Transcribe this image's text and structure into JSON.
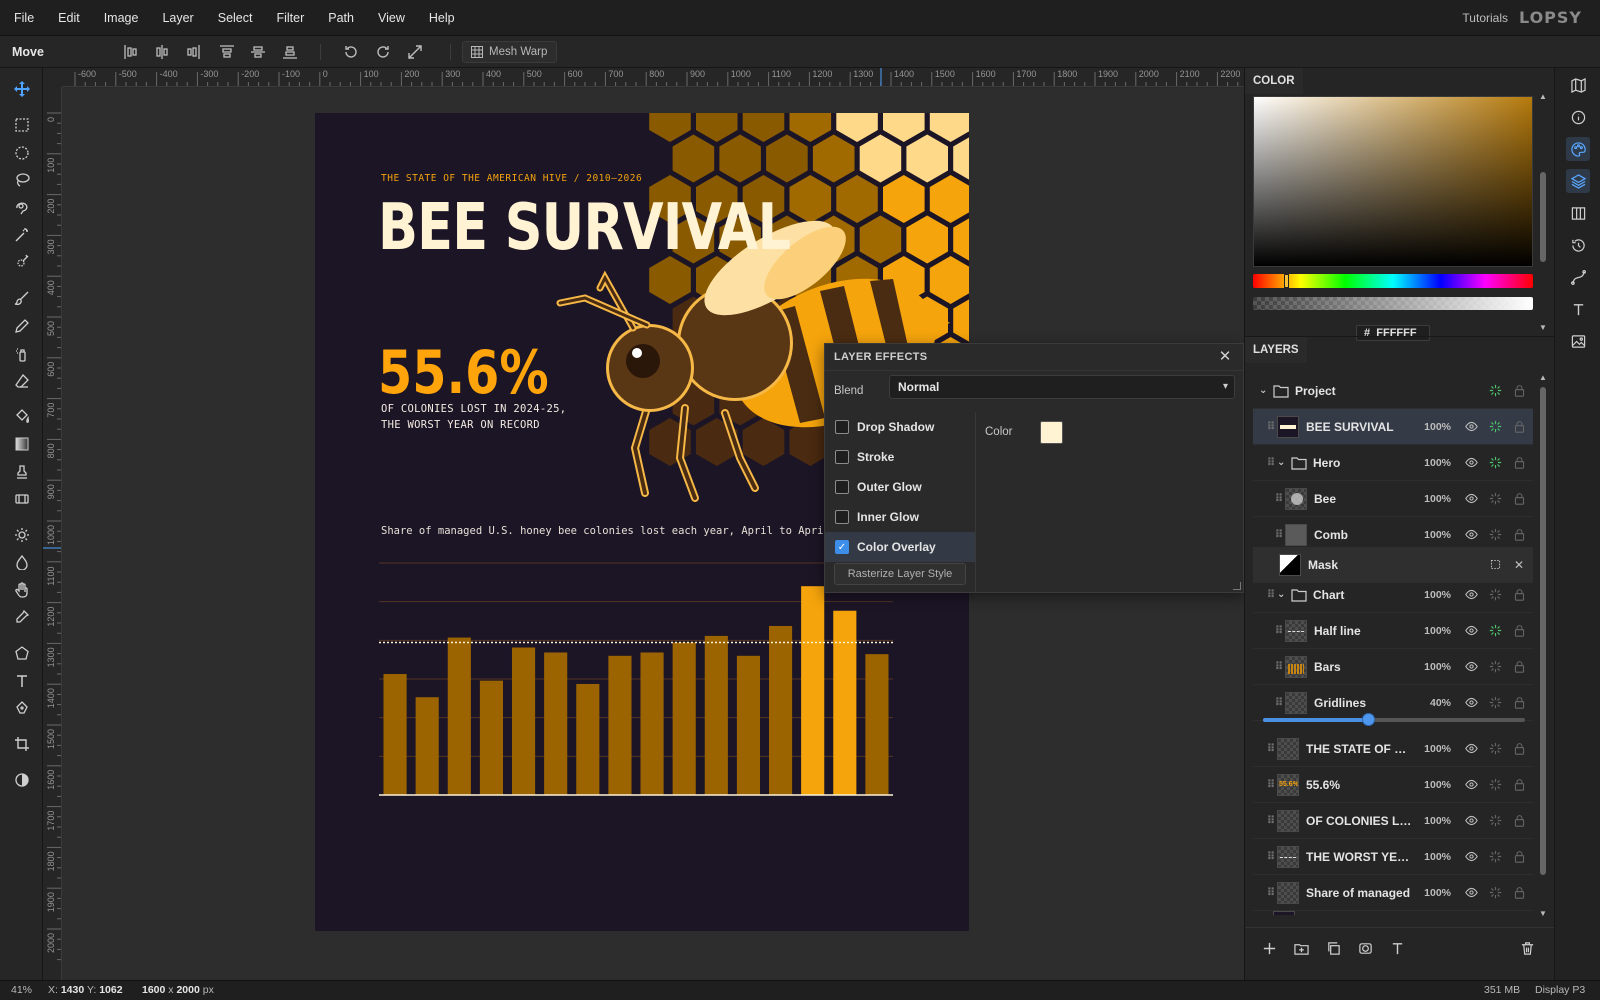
{
  "menu": [
    "File",
    "Edit",
    "Image",
    "Layer",
    "Select",
    "Filter",
    "Path",
    "View",
    "Help"
  ],
  "header": {
    "tutorials": "Tutorials",
    "logo": "LOPSY"
  },
  "optionbar": {
    "tool_name": "Move",
    "mesh_warp": "Mesh Warp"
  },
  "rulers": {
    "horizontal": [
      "-600",
      "-500",
      "-400",
      "-300",
      "-200",
      "-100",
      "0",
      "100",
      "200",
      "300",
      "400",
      "500",
      "600",
      "700",
      "800",
      "900",
      "1000",
      "1100",
      "1200",
      "1300",
      "1400",
      "1500",
      "1600",
      "1700",
      "1800",
      "1900",
      "2000",
      "2100",
      "2200"
    ],
    "vertical": [
      "0",
      "100",
      "200",
      "300",
      "400",
      "500",
      "600",
      "700",
      "800",
      "900",
      "1000",
      "1100",
      "1200",
      "1300",
      "1400",
      "1500",
      "1600",
      "1700",
      "1800",
      "1900",
      "2000"
    ]
  },
  "artboard": {
    "eyebrow": "THE STATE OF THE AMERICAN HIVE  /  2010–2026",
    "title": "BEE SURVIVAL",
    "stat": "55.6%",
    "sub1": "OF COLONIES LOST IN 2024-25,",
    "sub2": "THE WORST YEAR ON RECORD",
    "caption": "Share of managed U.S. honey bee colonies lost each year, April to April",
    "colors": {
      "bg": "#1c1526",
      "honey": "#f5a40c",
      "cream": "#fff3d4",
      "dark_bar": "#9c6400",
      "hex_dark": "#8a5a00"
    }
  },
  "chart_data": {
    "type": "bar",
    "values": [
      36.5,
      29.5,
      47.5,
      34.5,
      44.5,
      43,
      33.5,
      42,
      43,
      46,
      48,
      42,
      51,
      63,
      55.6,
      42.5
    ],
    "highlight_indices": [
      13,
      14
    ],
    "reference_line": 46,
    "ylim": [
      0,
      70
    ]
  },
  "layer_effects": {
    "title": "LAYER EFFECTS",
    "blend_label": "Blend",
    "blend_value": "Normal",
    "effects": [
      {
        "label": "Drop Shadow",
        "checked": false
      },
      {
        "label": "Stroke",
        "checked": false
      },
      {
        "label": "Outer Glow",
        "checked": false
      },
      {
        "label": "Inner Glow",
        "checked": false
      },
      {
        "label": "Color Overlay",
        "checked": true
      }
    ],
    "color_label": "Color",
    "overlay_color": "#fff3d4",
    "rasterize": "Rasterize Layer Style"
  },
  "color_panel": {
    "title": "COLOR",
    "hex_prefix": "#",
    "hex": "FFFFFF"
  },
  "layers_panel": {
    "title": "LAYERS",
    "project": "Project",
    "rows": [
      {
        "name": "BEE SURVIVAL",
        "opacity": "100%"
      },
      {
        "name": "Hero",
        "opacity": "100%"
      },
      {
        "name": "Bee",
        "opacity": "100%"
      },
      {
        "name": "Comb",
        "opacity": "100%"
      },
      {
        "name": "Mask",
        "opacity": ""
      },
      {
        "name": "Chart",
        "opacity": "100%"
      },
      {
        "name": "Half line",
        "opacity": "100%"
      },
      {
        "name": "Bars",
        "opacity": "100%"
      },
      {
        "name": "Gridlines",
        "opacity": "40%"
      },
      {
        "name": "THE STATE OF THE",
        "opacity": "100%"
      },
      {
        "name": "55.6%",
        "opacity": "100%"
      },
      {
        "name": "OF COLONIES LO...",
        "opacity": "100%"
      },
      {
        "name": "THE WORST YEA...",
        "opacity": "100%"
      },
      {
        "name": "Share of managed",
        "opacity": "100%"
      }
    ],
    "gridlines_opacity": 0.4
  },
  "status": {
    "zoom": "41%",
    "x_label": "X:",
    "x": "1430",
    "y_label": "Y:",
    "y": "1062",
    "w": "1600",
    "times": "x",
    "h": "2000",
    "unit": "px",
    "memory": "351 MB",
    "profile": "Display P3"
  }
}
